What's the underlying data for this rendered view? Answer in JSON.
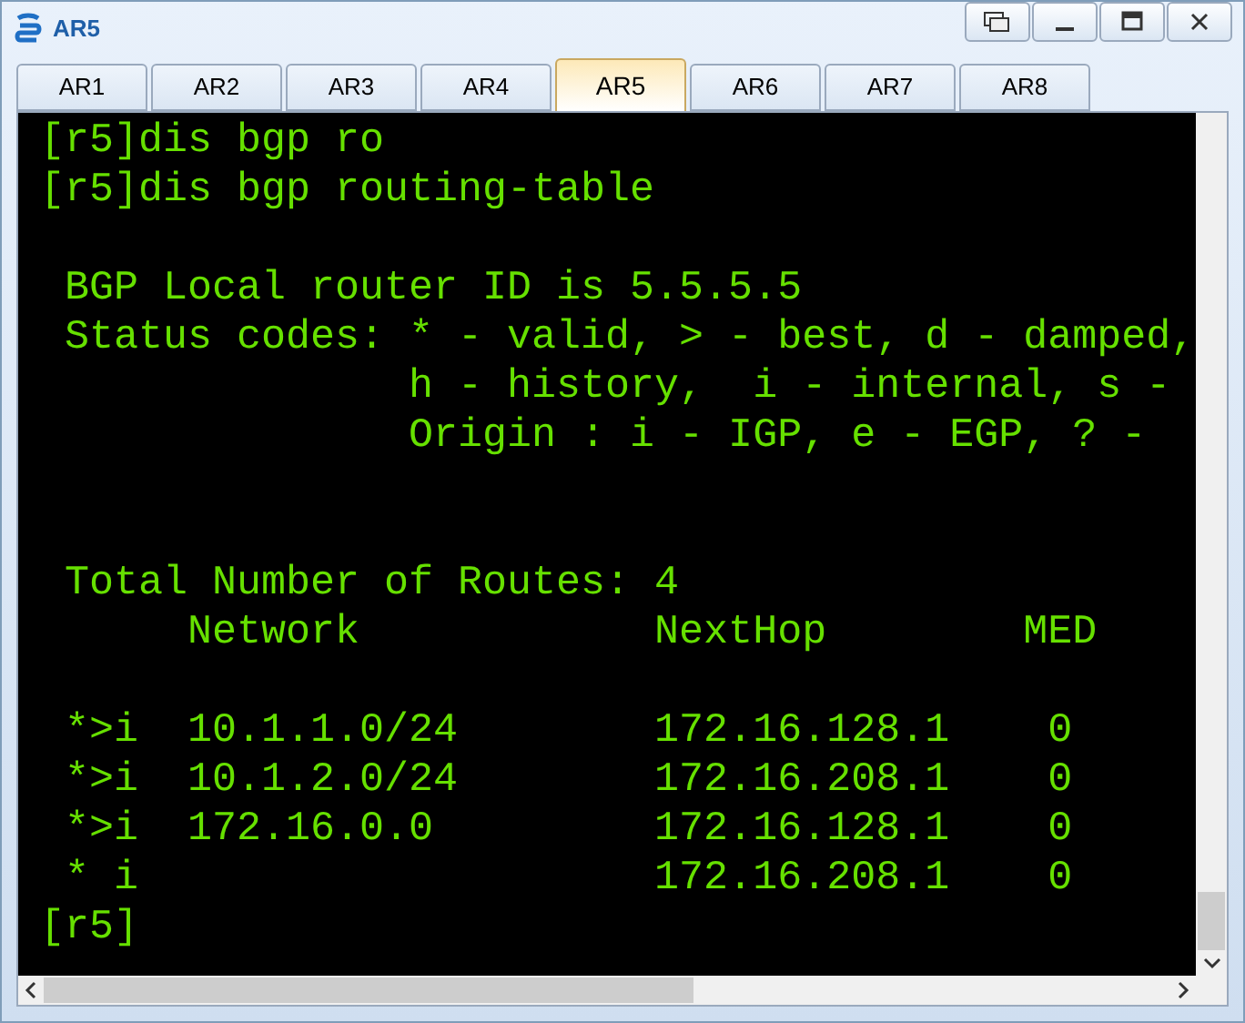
{
  "window": {
    "title": "AR5"
  },
  "tabs": [
    {
      "label": "AR1",
      "selected": false
    },
    {
      "label": "AR2",
      "selected": false
    },
    {
      "label": "AR3",
      "selected": false
    },
    {
      "label": "AR4",
      "selected": false
    },
    {
      "label": "AR5",
      "selected": true
    },
    {
      "label": "AR6",
      "selected": false
    },
    {
      "label": "AR7",
      "selected": false
    },
    {
      "label": "AR8",
      "selected": false
    }
  ],
  "terminal": {
    "lines": [
      {
        "kind": "line",
        "text": "[r5]dis bgp ro"
      },
      {
        "kind": "line",
        "text": "[r5]dis bgp routing-table"
      },
      {
        "kind": "blank"
      },
      {
        "kind": "line",
        "text": " BGP Local router ID is 5.5.5.5"
      },
      {
        "kind": "line",
        "text": " Status codes: * - valid, > - best, d - damped,"
      },
      {
        "kind": "line",
        "text": "               h - history,  i - internal, s -"
      },
      {
        "kind": "line",
        "text": "               Origin : i - IGP, e - EGP, ? -"
      },
      {
        "kind": "blank"
      },
      {
        "kind": "blank"
      },
      {
        "kind": "line",
        "text": " Total Number of Routes: 4"
      },
      {
        "kind": "line",
        "text": "      Network            NextHop        MED"
      },
      {
        "kind": "blank"
      },
      {
        "kind": "line",
        "text": " *>i  10.1.1.0/24        172.16.128.1    0"
      },
      {
        "kind": "line",
        "text": " *>i  10.1.2.0/24        172.16.208.1    0"
      },
      {
        "kind": "line",
        "text": " *>i  172.16.0.0         172.16.128.1    0"
      },
      {
        "kind": "line",
        "text": " * i                     172.16.208.1    0"
      },
      {
        "kind": "line",
        "text": "[r5]"
      }
    ]
  }
}
